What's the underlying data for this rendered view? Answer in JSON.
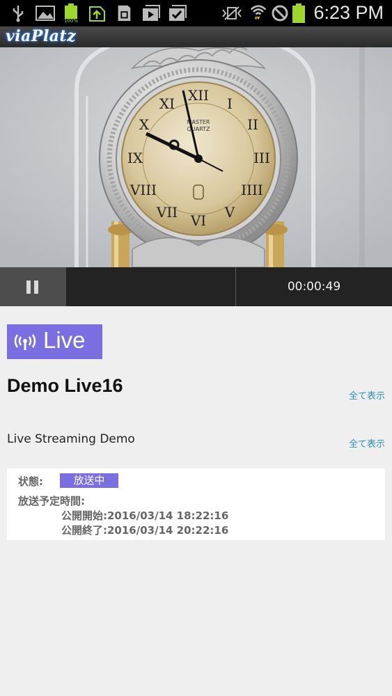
{
  "status_bar": {
    "time": "6:23 PM",
    "battery_percent": "100%",
    "icons": [
      "usb-icon",
      "image-icon",
      "battery-full-icon",
      "upload-icon",
      "sd-card-icon",
      "media-play-icon",
      "checklist-icon",
      "vibrate-off-icon",
      "wifi-icon",
      "blocked-icon",
      "battery-icon"
    ]
  },
  "app": {
    "logo": "viaPlatz"
  },
  "player": {
    "elapsed": "00:00:49",
    "state": "playing",
    "clock_dial_brand_line1": "MASTER",
    "clock_dial_brand_line2": "QUARTZ"
  },
  "content": {
    "live_label": "Live",
    "title": "Demo Live16",
    "show_all_1": "全て表示",
    "description": "Live Streaming Demo",
    "show_all_2": "全て表示"
  },
  "info": {
    "status_label": "状態:",
    "status_value": "放送中",
    "schedule_label": "放送予定時間:",
    "start": "公開開始:2016/03/14 18:22:16",
    "end": "公開終了:2016/03/14 20:22:16"
  },
  "colors": {
    "accent": "#7b6ee0",
    "link": "#2a8fbf",
    "battery_green": "#9fd62c"
  }
}
